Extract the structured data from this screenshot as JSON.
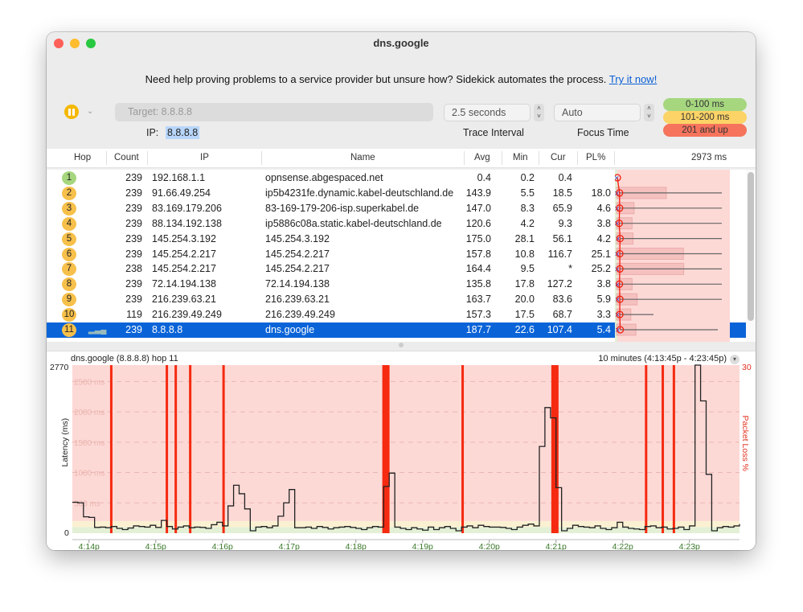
{
  "window": {
    "title": "dns.google"
  },
  "banner": {
    "text": "Need help proving problems to a service provider but unsure how? Sidekick automates the process.",
    "link": "Try it now!"
  },
  "controls": {
    "target_placeholder": "Target:  8.8.8.8",
    "ip_label": "IP:",
    "ip_value": "8.8.8.8",
    "trace_interval": "2.5 seconds",
    "trace_interval_label": "Trace Interval",
    "focus_time": "Auto",
    "focus_time_label": "Focus Time"
  },
  "legend": [
    {
      "label": "0-100 ms",
      "color": "#a6d77f"
    },
    {
      "label": "101-200 ms",
      "color": "#fcd366"
    },
    {
      "label": "201 and up",
      "color": "#f6735c"
    }
  ],
  "table": {
    "headers": {
      "hop": "Hop",
      "count": "Count",
      "ip": "IP",
      "name": "Name",
      "avg": "Avg",
      "min": "Min",
      "cur": "Cur",
      "pl": "PL%",
      "graph": "2973 ms"
    },
    "rows": [
      {
        "hop": "1",
        "count": "239",
        "ip": "192.168.1.1",
        "name": "opnsense.abgespaced.net",
        "avg": "0.4",
        "min": "0.2",
        "cur": "0.4",
        "pl": ""
      },
      {
        "hop": "2",
        "count": "239",
        "ip": "91.66.49.254",
        "name": "ip5b4231fe.dynamic.kabel-deutschland.de",
        "avg": "143.9",
        "min": "5.5",
        "cur": "18.5",
        "pl": "18.0"
      },
      {
        "hop": "3",
        "count": "239",
        "ip": "83.169.179.206",
        "name": "83-169-179-206-isp.superkabel.de",
        "avg": "147.0",
        "min": "8.3",
        "cur": "65.9",
        "pl": "4.6"
      },
      {
        "hop": "4",
        "count": "239",
        "ip": "88.134.192.138",
        "name": "ip5886c08a.static.kabel-deutschland.de",
        "avg": "120.6",
        "min": "4.2",
        "cur": "9.3",
        "pl": "3.8"
      },
      {
        "hop": "5",
        "count": "239",
        "ip": "145.254.3.192",
        "name": "145.254.3.192",
        "avg": "175.0",
        "min": "28.1",
        "cur": "56.1",
        "pl": "4.2"
      },
      {
        "hop": "6",
        "count": "239",
        "ip": "145.254.2.217",
        "name": "145.254.2.217",
        "avg": "157.8",
        "min": "10.8",
        "cur": "116.7",
        "pl": "25.1"
      },
      {
        "hop": "7",
        "count": "238",
        "ip": "145.254.2.217",
        "name": "145.254.2.217",
        "avg": "164.4",
        "min": "9.5",
        "cur": "*",
        "pl": "25.2"
      },
      {
        "hop": "8",
        "count": "239",
        "ip": "72.14.194.138",
        "name": "72.14.194.138",
        "avg": "135.8",
        "min": "17.8",
        "cur": "127.2",
        "pl": "3.8"
      },
      {
        "hop": "9",
        "count": "239",
        "ip": "216.239.63.21",
        "name": "216.239.63.21",
        "avg": "163.7",
        "min": "20.0",
        "cur": "83.6",
        "pl": "5.9"
      },
      {
        "hop": "10",
        "count": "119",
        "ip": "216.239.49.249",
        "name": "216.239.49.249",
        "avg": "157.3",
        "min": "17.5",
        "cur": "68.7",
        "pl": "3.3"
      },
      {
        "hop": "11",
        "count": "239",
        "ip": "8.8.8.8",
        "name": "dns.google",
        "avg": "187.7",
        "min": "22.6",
        "cur": "107.4",
        "pl": "5.4",
        "selected": true
      }
    ]
  },
  "chart_data": {
    "type": "line",
    "title": "dns.google (8.8.8.8) hop 11",
    "range_label": "10 minutes (4:13:45p - 4:23:45p)",
    "ylabel": "Latency (ms)",
    "y2label": "Packet Loss %",
    "ylim": [
      0,
      2770
    ],
    "y2max": "30",
    "ymax_label": "2770",
    "ymin_label": "0",
    "gridlines": [
      {
        "v": 500,
        "label": "500 ms"
      },
      {
        "v": 1000,
        "label": "1000 ms"
      },
      {
        "v": 1500,
        "label": "1500 ms"
      },
      {
        "v": 2000,
        "label": "2000 ms"
      },
      {
        "v": 2500,
        "label": "2500 ms"
      }
    ],
    "duration_s": 600,
    "step_s": 5,
    "x_ticks": [
      {
        "t": 15,
        "label": "4:14p"
      },
      {
        "t": 75,
        "label": "4:15p"
      },
      {
        "t": 135,
        "label": "4:16p"
      },
      {
        "t": 195,
        "label": "4:17p"
      },
      {
        "t": 255,
        "label": "4:18p"
      },
      {
        "t": 315,
        "label": "4:19p"
      },
      {
        "t": 375,
        "label": "4:20p"
      },
      {
        "t": 435,
        "label": "4:21p"
      },
      {
        "t": 495,
        "label": "4:22p"
      },
      {
        "t": 555,
        "label": "4:23p"
      }
    ],
    "latency_ms": [
      510,
      500,
      270,
      260,
      95,
      100,
      90,
      110,
      80,
      60,
      85,
      120,
      110,
      100,
      130,
      95,
      210,
      110,
      70,
      100,
      120,
      90,
      100,
      95,
      80,
      140,
      180,
      120,
      450,
      790,
      650,
      400,
      40,
      100,
      110,
      90,
      120,
      280,
      500,
      720,
      90,
      90,
      100,
      80,
      110,
      95,
      70,
      90,
      100,
      110,
      95,
      80,
      60,
      90,
      110,
      100,
      770,
      990,
      100,
      80,
      60,
      90,
      70,
      50,
      100,
      60,
      90,
      110,
      80,
      40,
      100,
      120,
      90,
      130,
      110,
      100,
      100,
      95,
      80,
      60,
      100,
      130,
      150,
      120,
      1430,
      2070,
      1900,
      750,
      40,
      80,
      130,
      110,
      100,
      90,
      120,
      80,
      60,
      90,
      180,
      100,
      80,
      70,
      60,
      110,
      120,
      90,
      100,
      70,
      80,
      100,
      60,
      120,
      2770,
      2180,
      970,
      40,
      90,
      110,
      100,
      120,
      150
    ],
    "loss_events": [
      {
        "t": 35,
        "w": 1
      },
      {
        "t": 85,
        "w": 1
      },
      {
        "t": 93,
        "w": 1
      },
      {
        "t": 106,
        "w": 1
      },
      {
        "t": 136,
        "w": 1
      },
      {
        "t": 282,
        "w": 3
      },
      {
        "t": 351,
        "w": 1
      },
      {
        "t": 434,
        "w": 3
      },
      {
        "t": 516,
        "w": 1
      },
      {
        "t": 531,
        "w": 1
      },
      {
        "t": 541,
        "w": 1
      }
    ],
    "bands": [
      {
        "from": 0,
        "to": 100,
        "color": "#e3f0d6"
      },
      {
        "from": 100,
        "to": 200,
        "color": "#fbf1d2"
      },
      {
        "from": 200,
        "to": 2770,
        "color": "#fdd9d6"
      }
    ]
  }
}
